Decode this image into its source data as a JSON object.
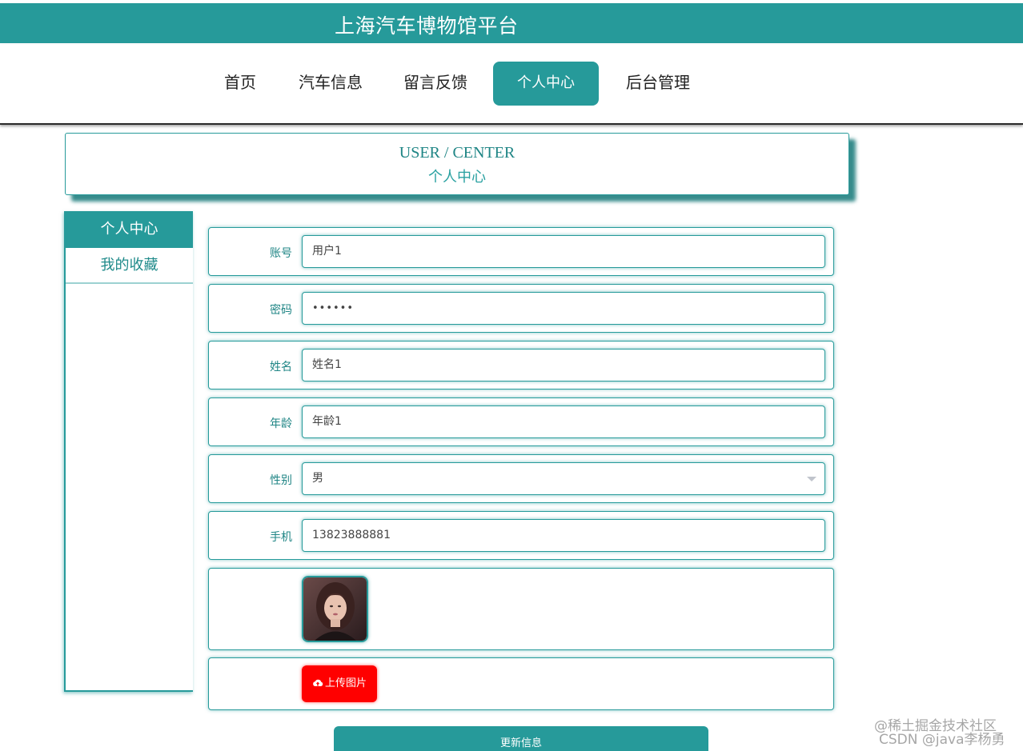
{
  "header": {
    "title": "上海汽车博物馆平台"
  },
  "nav": {
    "items": [
      {
        "label": "首页"
      },
      {
        "label": "汽车信息"
      },
      {
        "label": "留言反馈"
      },
      {
        "label": "个人中心"
      },
      {
        "label": "后台管理"
      }
    ],
    "active": "个人中心"
  },
  "banner": {
    "en": "USER / CENTER",
    "cn": "个人中心"
  },
  "sidebar": {
    "items": [
      {
        "label": "个人中心"
      },
      {
        "label": "我的收藏"
      }
    ]
  },
  "form": {
    "account": {
      "label": "账号",
      "value": "用户1"
    },
    "password": {
      "label": "密码",
      "value": "••••••"
    },
    "name": {
      "label": "姓名",
      "value": "姓名1"
    },
    "age": {
      "label": "年龄",
      "value": "年龄1"
    },
    "gender": {
      "label": "性别",
      "value": "男"
    },
    "phone": {
      "label": "手机",
      "value": "13823888881"
    },
    "upload_label": "上传图片",
    "submit_label": "更新信息"
  },
  "watermark": {
    "line1": "@稀土掘金技术社区",
    "line2": "CSDN @java李杨勇"
  },
  "colors": {
    "primary": "#269a9a",
    "upload": "#ff0000"
  }
}
